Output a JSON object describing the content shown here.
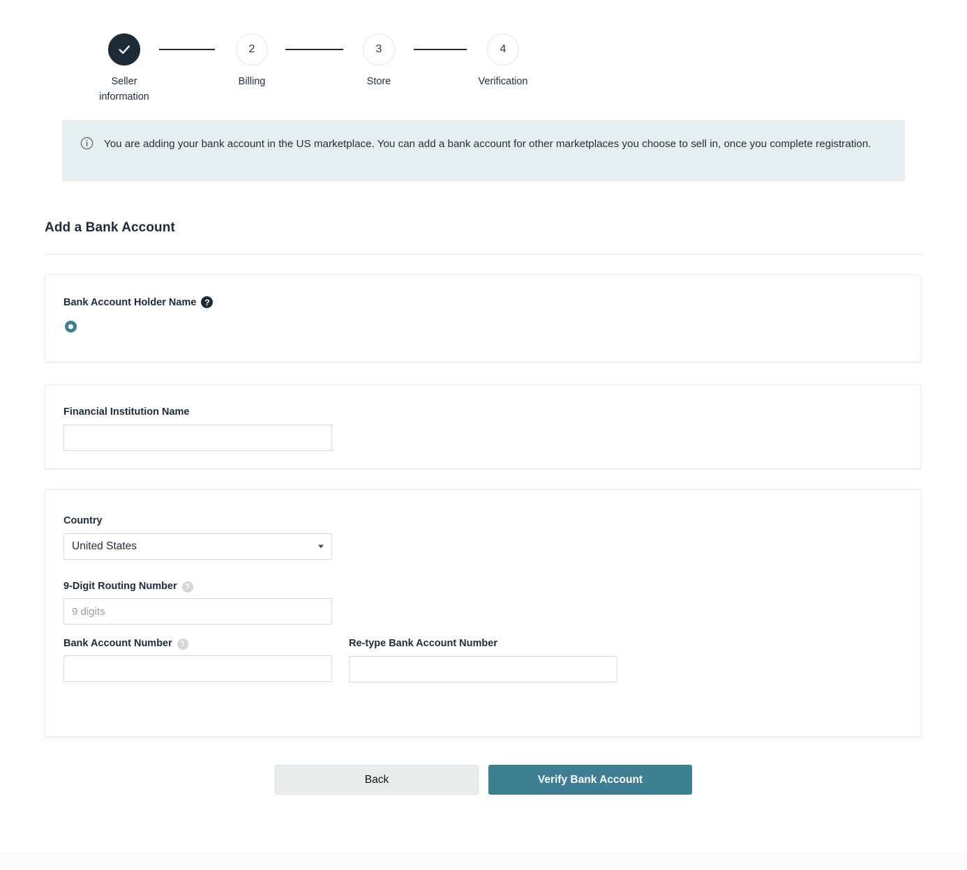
{
  "stepper": {
    "steps": [
      {
        "marker": "check-icon",
        "label": "Seller\ninformation",
        "state": "completed"
      },
      {
        "marker": "2",
        "label": "Billing",
        "state": "upcoming"
      },
      {
        "marker": "3",
        "label": "Store",
        "state": "upcoming"
      },
      {
        "marker": "4",
        "label": "Verification",
        "state": "upcoming"
      }
    ]
  },
  "banner": {
    "icon": "info-circle-icon",
    "text": "You are adding your bank account in the US marketplace. You can add a bank account for other marketplaces you choose to sell in, once you complete registration.",
    "background": "#e7eef1"
  },
  "page": {
    "title": "Add a Bank Account"
  },
  "holder_card": {
    "label": "Bank Account Holder Name",
    "help_icon": "question-mark-circle-dark-icon",
    "radio_selected": true
  },
  "institution_card": {
    "label": "Financial Institution Name",
    "value": "",
    "placeholder": ""
  },
  "account_card": {
    "country": {
      "label": "Country",
      "selected": "United States",
      "options": [
        "United States"
      ],
      "caret_icon": "chevron-down-icon"
    },
    "routing": {
      "label": "9-Digit Routing Number",
      "help_icon": "question-mark-circle-grey-icon",
      "value": "",
      "placeholder": "9 digits"
    },
    "account_number": {
      "label": "Bank Account Number",
      "help_icon": "question-mark-circle-grey-icon",
      "value": "",
      "placeholder": ""
    },
    "retype_account_number": {
      "label": "Re-type Bank Account Number",
      "value": "",
      "placeholder": ""
    }
  },
  "footer": {
    "back_label": "Back",
    "verify_label": "Verify Bank Account",
    "accent_color": "#3f7f93"
  }
}
